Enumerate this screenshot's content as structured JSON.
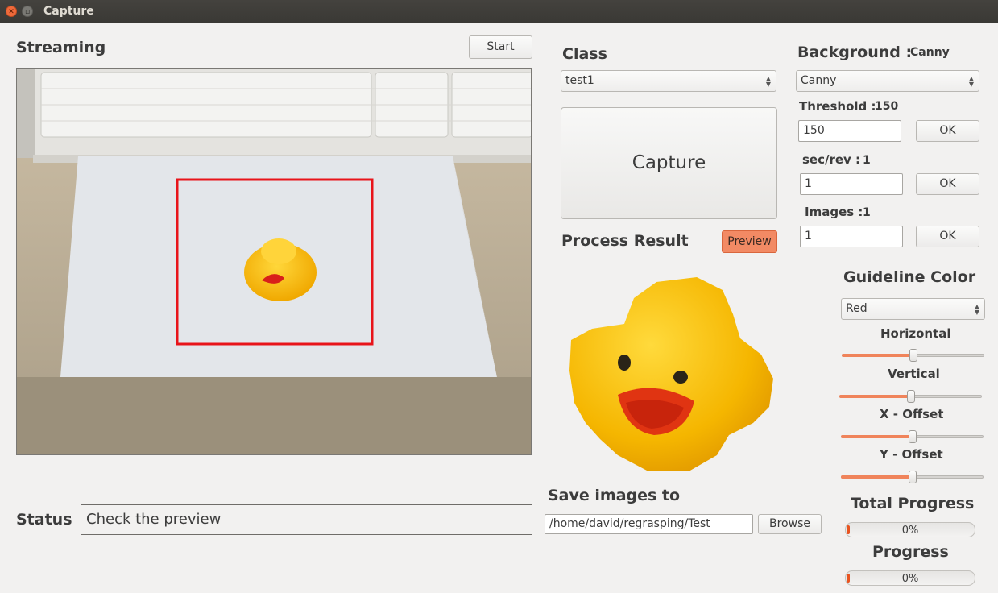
{
  "window": {
    "title": "Capture"
  },
  "streaming": {
    "label": "Streaming",
    "start_button": "Start"
  },
  "status": {
    "label": "Status",
    "text": "Check the preview"
  },
  "class_section": {
    "label": "Class",
    "selected": "test1",
    "capture_button": "Capture"
  },
  "process": {
    "label": "Process Result",
    "preview_button": "Preview"
  },
  "save": {
    "label": "Save images to",
    "path": "/home/david/regrasping/Test",
    "browse_button": "Browse"
  },
  "background": {
    "label": "Background :",
    "value": "Canny",
    "selected": "Canny",
    "threshold": {
      "label": "Threshold :",
      "value": "150",
      "input": "150",
      "ok": "OK"
    },
    "sec_rev": {
      "label": "sec/rev :",
      "value": "1",
      "input": "1",
      "ok": "OK"
    },
    "images": {
      "label": "Images :",
      "value": "1",
      "input": "1",
      "ok": "OK"
    }
  },
  "guideline": {
    "label": "Guideline Color",
    "selected": "Red",
    "sliders": [
      {
        "label": "Horizontal",
        "value": 0.5
      },
      {
        "label": "Vertical",
        "value": 0.5
      },
      {
        "label": "X - Offset",
        "value": 0.5
      },
      {
        "label": "Y - Offset",
        "value": 0.5
      }
    ]
  },
  "total_progress": {
    "label": "Total Progress",
    "value": "0%"
  },
  "progress": {
    "label": "Progress",
    "value": "0%"
  },
  "colors": {
    "accent": "#e95420",
    "guideline": "#e8141a",
    "preview_button": "#f28a64"
  }
}
